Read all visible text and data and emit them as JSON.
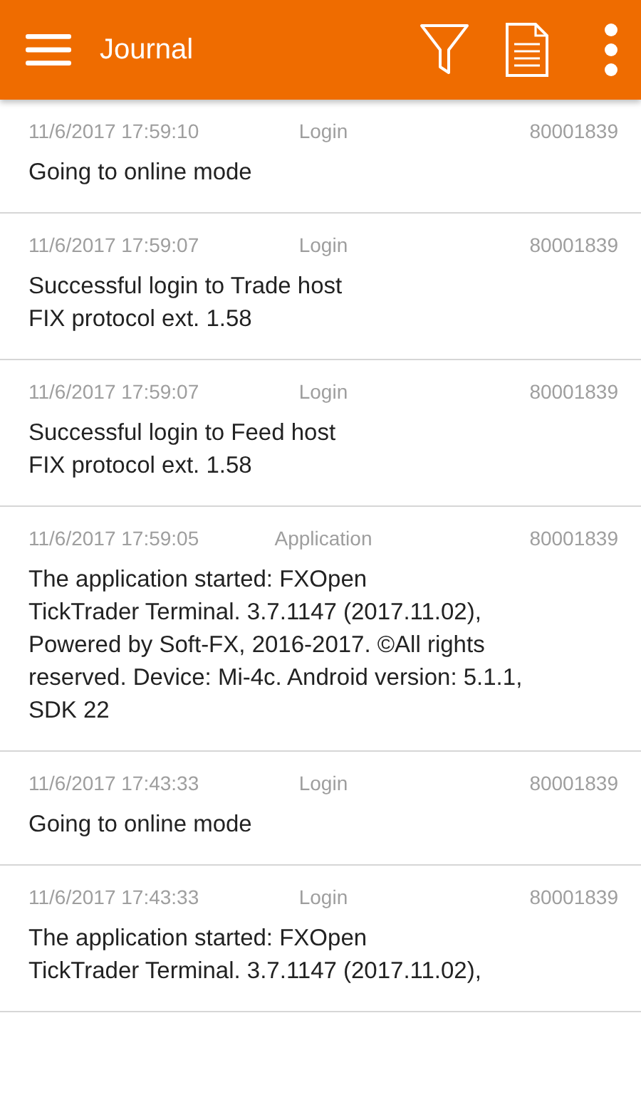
{
  "app_bar": {
    "title": "Journal"
  },
  "entries": [
    {
      "time": "11/6/2017 17:59:10",
      "category": "Login",
      "account": "80001839",
      "lines": [
        "Going to online mode"
      ]
    },
    {
      "time": "11/6/2017 17:59:07",
      "category": "Login",
      "account": "80001839",
      "lines": [
        "Successful login to Trade host",
        "FIX protocol ext. 1.58"
      ]
    },
    {
      "time": "11/6/2017 17:59:07",
      "category": "Login",
      "account": "80001839",
      "lines": [
        "Successful login to Feed host",
        "FIX protocol ext. 1.58"
      ]
    },
    {
      "time": "11/6/2017 17:59:05",
      "category": "Application",
      "account": "80001839",
      "lines": [
        "The application started: FXOpen",
        "TickTrader Terminal. 3.7.1147 (2017.11.02),",
        "Powered by Soft-FX, 2016-2017. ©All rights",
        "reserved. Device: Mi-4c. Android version: 5.1.1,",
        "SDK 22"
      ]
    },
    {
      "time": "11/6/2017 17:43:33",
      "category": "Login",
      "account": "80001839",
      "lines": [
        "Going to online mode"
      ]
    },
    {
      "time": "11/6/2017 17:43:33",
      "category": "Login",
      "account": "80001839",
      "lines": [
        "The application started: FXOpen",
        "TickTrader Terminal. 3.7.1147 (2017.11.02),"
      ]
    }
  ]
}
